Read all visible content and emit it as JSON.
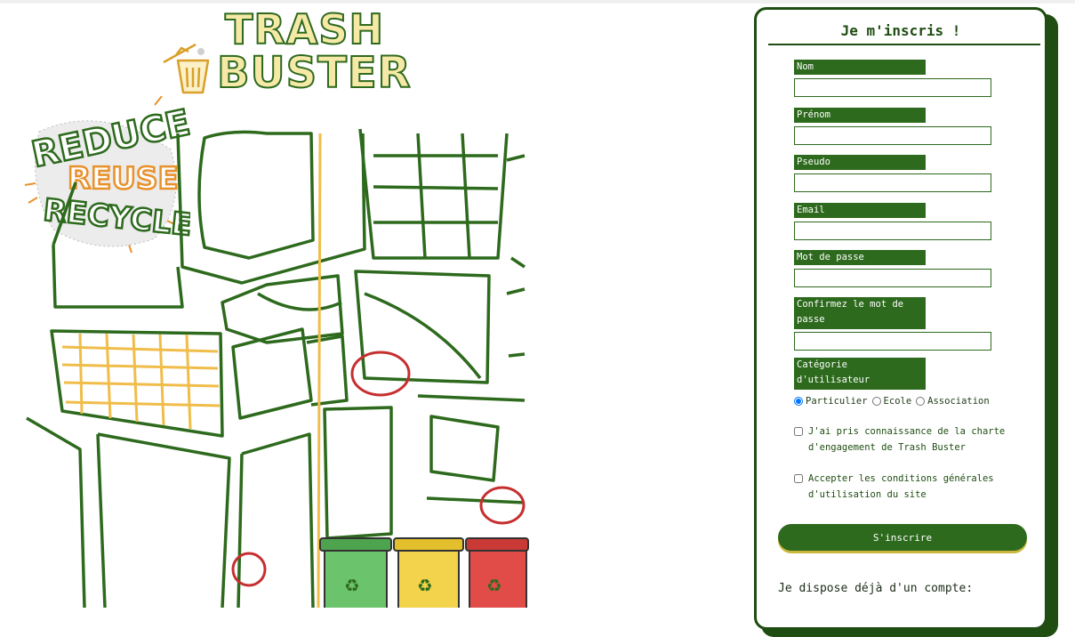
{
  "brand": {
    "line1": "TRASH",
    "line2": "BUSTER"
  },
  "badge": {
    "line1": "REDUCE",
    "line2": "REUSE",
    "line3": "RECYCLE"
  },
  "colors": {
    "primary_green": "#2d6a1d",
    "dark_green": "#1f4d12",
    "logo_yellow": "#f6e9a7",
    "orange": "#e9912b",
    "bin_green": "#6bc36b",
    "bin_yellow": "#f2d34b",
    "bin_red": "#e24c48",
    "red_circle": "#c62f2f"
  },
  "form": {
    "title": "Je m'inscris !",
    "fields": [
      {
        "label": "Nom",
        "value": "",
        "placeholder": ""
      },
      {
        "label": "Prénom",
        "value": "",
        "placeholder": ""
      },
      {
        "label": "Pseudo",
        "value": "",
        "placeholder": ""
      },
      {
        "label": "Email",
        "value": "",
        "placeholder": ""
      },
      {
        "label": "Mot de passe",
        "value": "",
        "placeholder": ""
      },
      {
        "label": "Confirmez le mot de passe",
        "value": "",
        "placeholder": ""
      }
    ],
    "category": {
      "label": "Catégorie d'utilisateur",
      "options": [
        "Particulier",
        "Ecole",
        "Association"
      ],
      "selected": "Particulier"
    },
    "checkboxes": [
      {
        "text": "J'ai pris connaissance de la charte d'engagement de Trash Buster",
        "checked": false
      },
      {
        "text": "Accepter les conditions générales d'utilisation du site",
        "checked": false
      }
    ],
    "submit_label": "S'inscrire",
    "existing_account_text": "Je dispose déjà d'un compte:"
  }
}
